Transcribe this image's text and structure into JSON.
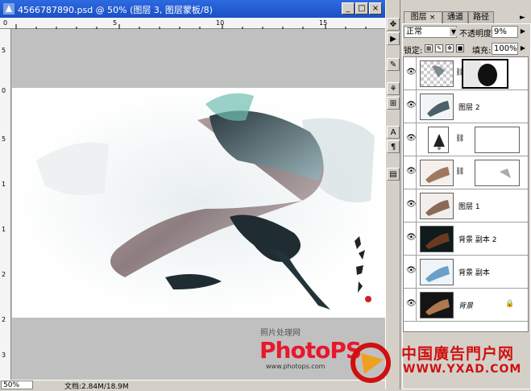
{
  "window": {
    "title": "4566787890.psd @ 50% (图层 3, 图层蒙板/8)",
    "buttons": {
      "minimize": "_",
      "maximize": "□",
      "close": "×"
    }
  },
  "rulers": {
    "top_ticks": [
      "0",
      "5",
      "10",
      "15"
    ],
    "left_ticks": [
      "5",
      "0",
      "5",
      "1",
      "1",
      "2",
      "2",
      "3"
    ]
  },
  "status": {
    "zoom": "50%",
    "doc_info": "文档:2.84M/18.9M"
  },
  "watermark": {
    "sub": "照片处理网",
    "logo": "PhotoPS",
    "url": "www.photops.com",
    "yxad_cn": "中国廣告門户网",
    "yxad_en": "WWW.YXAD.COM"
  },
  "layers_panel": {
    "tabs": [
      "图层",
      "通道",
      "路径"
    ],
    "tab_close": "×",
    "blend_mode": "正常",
    "opacity_label": "不透明度:",
    "opacity": "9%",
    "lock_label": "锁定:",
    "fill_label": "填充:",
    "fill": "100%",
    "layers": [
      {
        "name": "",
        "type": "masked",
        "selected": true
      },
      {
        "name": "图层 2",
        "type": "image"
      },
      {
        "name": "",
        "type": "adjustment"
      },
      {
        "name": "",
        "type": "masked"
      },
      {
        "name": "图层 1",
        "type": "image"
      },
      {
        "name": "背景 副本 2",
        "type": "dark"
      },
      {
        "name": "背景 副本",
        "type": "image"
      },
      {
        "name": "背景",
        "type": "dark",
        "locked": true
      }
    ]
  },
  "tools": [
    "move",
    "play",
    "brush",
    "stamp",
    "history",
    "text",
    "paragraph",
    "layer-comp"
  ],
  "colors": {
    "title_bar": "#1c4fc4",
    "canvas_gray": "#c0c0c0",
    "accent_red": "#e8172b"
  }
}
